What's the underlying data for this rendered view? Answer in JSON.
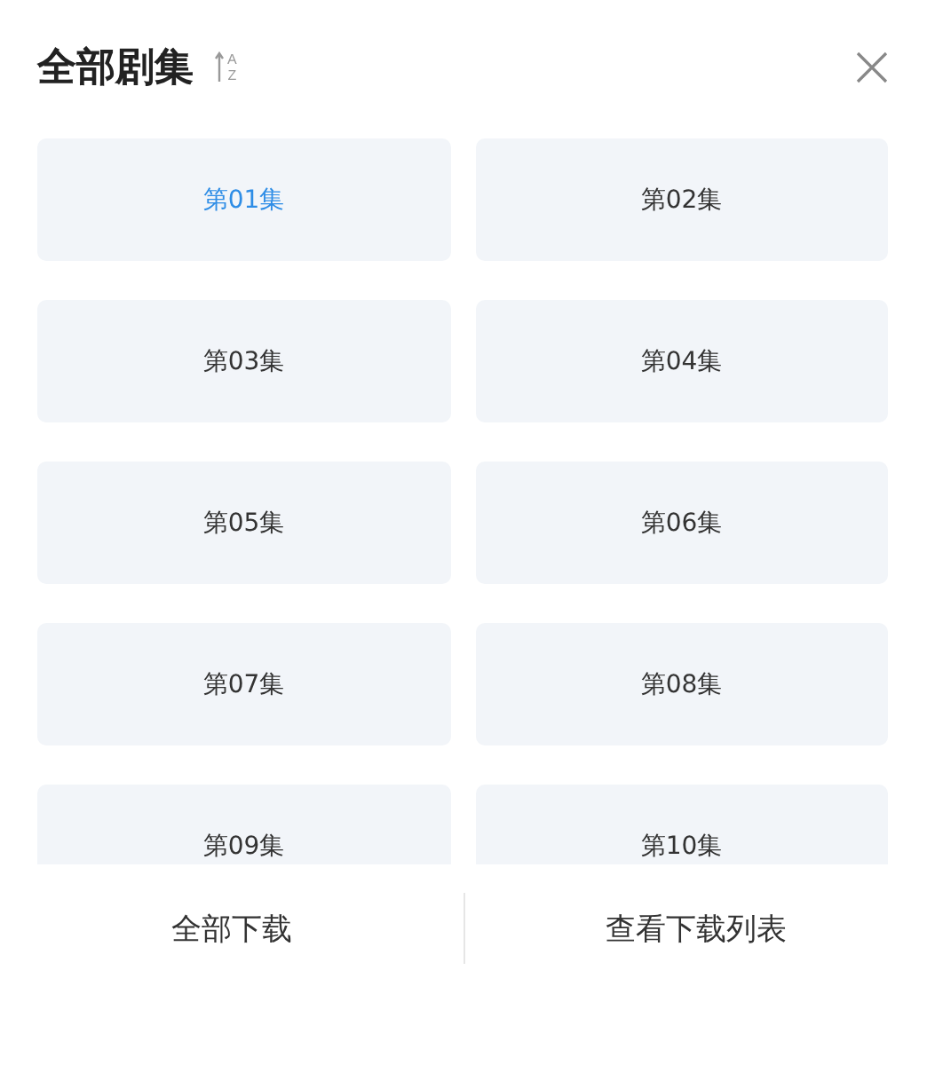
{
  "header": {
    "title": "全部剧集",
    "sort": {
      "top": "A",
      "bottom": "Z"
    }
  },
  "episodes": [
    {
      "label": "第01集",
      "selected": true
    },
    {
      "label": "第02集",
      "selected": false
    },
    {
      "label": "第03集",
      "selected": false
    },
    {
      "label": "第04集",
      "selected": false
    },
    {
      "label": "第05集",
      "selected": false
    },
    {
      "label": "第06集",
      "selected": false
    },
    {
      "label": "第07集",
      "selected": false
    },
    {
      "label": "第08集",
      "selected": false
    },
    {
      "label": "第09集",
      "selected": false
    },
    {
      "label": "第10集",
      "selected": false
    }
  ],
  "footer": {
    "buttons": [
      "全部下载",
      "查看下载列表"
    ]
  }
}
